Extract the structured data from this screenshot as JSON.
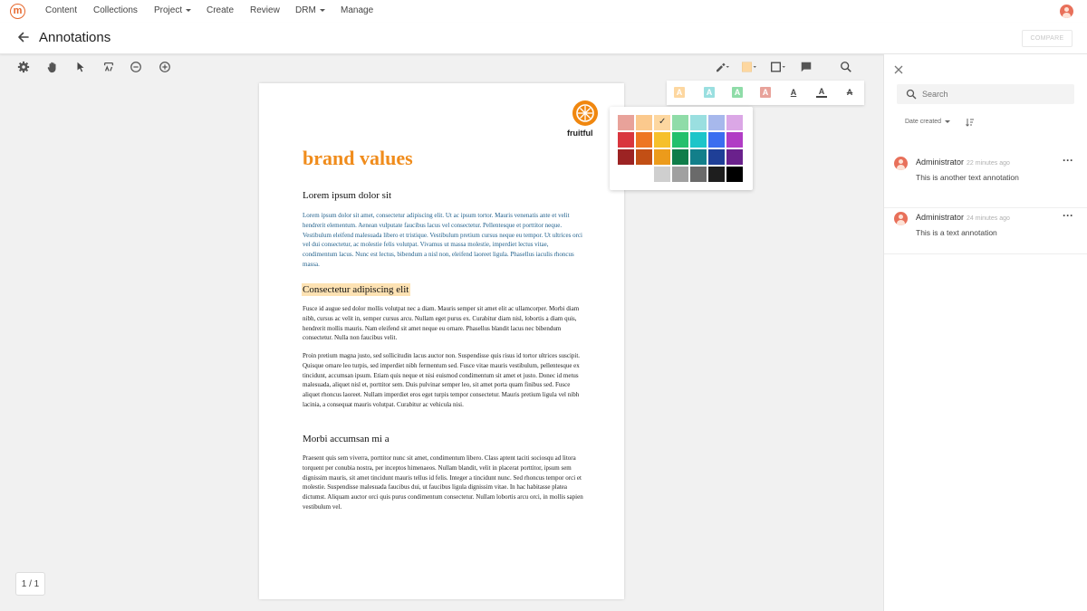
{
  "nav": {
    "logo": "m",
    "items": [
      {
        "label": "Content",
        "dropdown": false
      },
      {
        "label": "Collections",
        "dropdown": false
      },
      {
        "label": "Project",
        "dropdown": true
      },
      {
        "label": "Create",
        "dropdown": false
      },
      {
        "label": "Review",
        "dropdown": false
      },
      {
        "label": "DRM",
        "dropdown": true
      },
      {
        "label": "Manage",
        "dropdown": false
      }
    ]
  },
  "header": {
    "title": "Annotations",
    "compare_label": "COMPARE"
  },
  "toolbar": {
    "left_icons": [
      "gear-icon",
      "hand-icon",
      "pointer-icon",
      "crop-icon",
      "zoom-out-icon",
      "zoom-in-icon"
    ],
    "right_icons": [
      "pen-icon",
      "highlight-color-icon",
      "shape-icon",
      "comment-icon",
      "search-icon"
    ]
  },
  "format_bar": {
    "items": [
      {
        "label": "A",
        "style": "bg-yellow"
      },
      {
        "label": "A",
        "style": "bg-cyan"
      },
      {
        "label": "A",
        "style": "bg-green"
      },
      {
        "label": "A",
        "style": "bg-red"
      },
      {
        "label": "A",
        "style": "underline"
      },
      {
        "label": "A",
        "style": "underline-thick"
      },
      {
        "label": "A",
        "style": "strikethrough"
      }
    ]
  },
  "palette": {
    "selected": "#fdd7a0",
    "rows": [
      [
        "#e8a29a",
        "#fbc98d",
        "#fdd7a0",
        "#8fdca8",
        "#9adfe0",
        "#a7b8ec",
        "#dba7e6"
      ],
      [
        "#d9363e",
        "#ee7622",
        "#f6c02b",
        "#24c06c",
        "#1cc5c9",
        "#3b6ef0",
        "#b13dc5"
      ],
      [
        "#9c2323",
        "#c24f15",
        "#ec9b1b",
        "#0f7d49",
        "#127f8a",
        "#1f3f97",
        "#6a218c"
      ],
      [
        "#ffffff",
        "#ffffff",
        "#cfcfcf",
        "#a0a0a0",
        "#6a6a6a",
        "#1e1e1e",
        "#000000"
      ]
    ]
  },
  "document": {
    "logo_text": "fruitful",
    "title": "brand values",
    "heading1": "Lorem ipsum dolor sit",
    "para1": "Lorem ipsum dolor sit amet, consectetur adipiscing elit. Ut ac ipsum tortor. Mauris venenatis ante et velit hendrerit elementum. Aenean vulputate faucibus lacus vel consectetur. Pellentesque et porttitor neque. Vestibulum eleifend malesuada libero et tristique. Vestibulum pretium cursus neque eu tempor. Ut ultrices orci vel dui consectetur, ac molestie felis volutpat. Vivamus ut massa molestie, imperdiet lectus vitae, condimentum lacus. Nunc est lectus, bibendum a nisl non, eleifend laoreet ligula. Phasellus iaculis rhoncus massa.",
    "heading2": "Consectetur adipiscing elit",
    "para2": "Fusce id augue sed dolor mollis volutpat nec a diam. Mauris semper sit amet elit ac ullamcorper. Morbi diam nibh, cursus ac velit in, semper cursus arcu. Nullam eget purus ex. Curabitur diam nisl, lobortis a diam quis, hendrerit mollis mauris. Nam eleifend sit amet neque eu ornare. Phasellus blandit lacus nec bibendum consectetur. Nulla non faucibus velit.",
    "para3": "Proin pretium magna justo, sed sollicitudin lacus auctor non. Suspendisse quis risus id tortor ultrices suscipit. Quisque ornare leo turpis, sed imperdiet nibh fermentum sed. Fusce vitae mauris vestibulum, pellentesque ex tincidunt, accumsan ipsum. Etiam quis neque et nisi euismod condimentum sit amet et justo. Donec id metus malesuada, aliquet nisl et, porttitor sem. Duis pulvinar semper leo, sit amet porta quam finibus sed. Fusce aliquet rhoncus laoreet. Nullam imperdiet eros eget turpis tempor consectetur. Mauris pretium ligula vel nibh lacinia, a consequat mauris volutpat. Curabitur ac vehicula nisi.",
    "heading3": "Morbi accumsan mi a",
    "para4": "Praesent quis sem viverra, porttitor nunc sit amet, condimentum libero. Class aptent taciti sociosqu ad litora torquent per conubia nostra, per inceptos himenaeos. Nullam blandit, velit in placerat porttitor, ipsum sem dignissim mauris, sit amet tincidunt mauris tellus id felis. Integer a tincidunt nunc. Sed rhoncus tempor orci et molestie. Suspendisse malesuada faucibus dui, ut faucibus ligula dignissim vitae. In hac habitasse platea dictumst. Aliquam auctor orci quis purus condimentum consectetur. Nullam lobortis arcu orci, in mollis sapien vestibulum vel."
  },
  "pager": {
    "label": "1 / 1"
  },
  "panel": {
    "search_placeholder": "Search",
    "sort_label": "Date created",
    "comments": [
      {
        "author": "Administrator",
        "time": "22 minutes ago",
        "text": "This is another text annotation"
      },
      {
        "author": "Administrator",
        "time": "24 minutes ago",
        "text": "This is a text annotation"
      }
    ]
  }
}
